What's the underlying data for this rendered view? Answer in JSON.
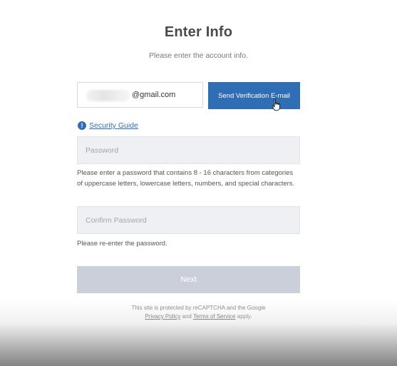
{
  "header": {
    "title": "Enter Info",
    "subtitle": "Please enter the account info."
  },
  "email": {
    "domain": "@gmail.com",
    "send_button_label": "Send Verification E-mail"
  },
  "security_guide": {
    "icon": "info-icon",
    "label": "Security Guide"
  },
  "password": {
    "placeholder": "Password",
    "value": "",
    "hint": "Please enter a password that contains 8 - 16 characters from categories of uppercase letters, lowercase letters, numbers, and special characters."
  },
  "confirm_password": {
    "placeholder": "Confirm Password",
    "value": "",
    "hint": "Please re-enter the password."
  },
  "next_button_label": "Next",
  "recaptcha": {
    "line1": "This site is protected by reCAPTCHA and the Google",
    "privacy_link": "Privacy Policy",
    "and": "and",
    "terms_link": "Terms of Service",
    "apply": "apply."
  },
  "colors": {
    "primary": "#2f6db5",
    "disabled_button": "#c9d0d9",
    "field_bg": "#eff0f3"
  }
}
